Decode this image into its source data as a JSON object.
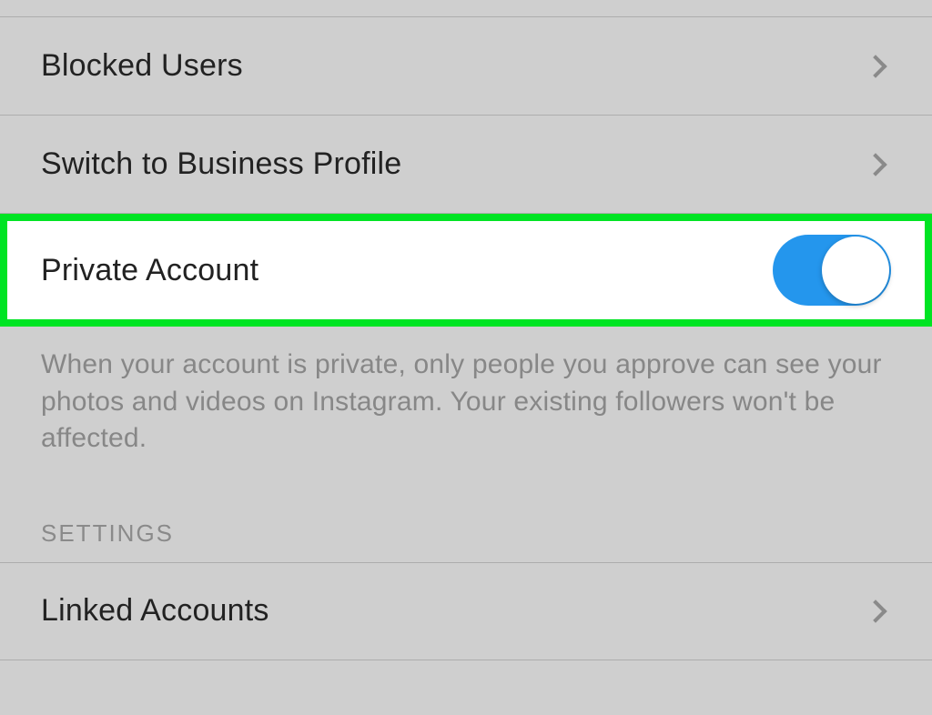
{
  "rows": {
    "blocked_users": "Blocked Users",
    "switch_business": "Switch to Business Profile",
    "private_account": "Private Account",
    "linked_accounts": "Linked Accounts"
  },
  "description": "When your account is private, only people you approve can see your photos and videos on Instagram. Your existing followers won't be affected.",
  "section_header": "SETTINGS",
  "toggle_private_on": true
}
